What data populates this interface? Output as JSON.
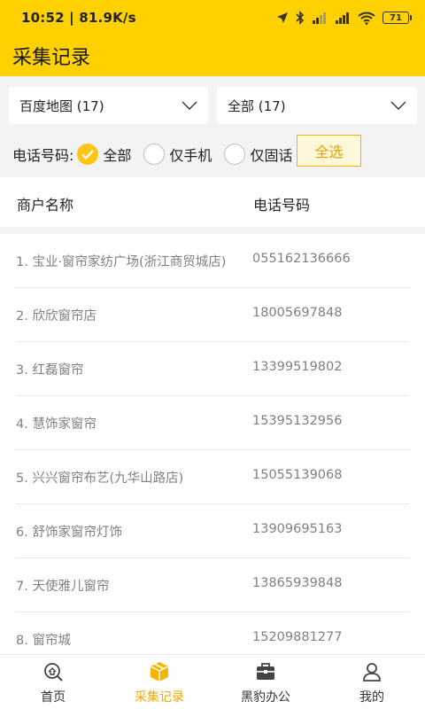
{
  "status_bar": {
    "time_speed": "10:52 | 81.9K/s",
    "battery": "71"
  },
  "header": {
    "title": "采集记录"
  },
  "filters": {
    "source_dropdown": "百度地图 (17)",
    "category_dropdown": "全部 (17)",
    "phone_label": "电话号码:",
    "phone_options": [
      "全部",
      "仅手机",
      "仅固话"
    ],
    "selected_option": "全部",
    "select_all_label": "全选"
  },
  "table": {
    "headers": {
      "name": "商户名称",
      "phone": "电话号码"
    },
    "rows": [
      {
        "name": "1. 宝业·窗帘家纺广场(浙江商贸城店)",
        "phone": "055162136666"
      },
      {
        "name": "2. 欣欣窗帘店",
        "phone": "18005697848"
      },
      {
        "name": "3. 红磊窗帘",
        "phone": "13399519802"
      },
      {
        "name": "4. 慧饰家窗帘",
        "phone": "15395132956"
      },
      {
        "name": "5. 兴兴窗帘布艺(九华山路店)",
        "phone": "15055139068"
      },
      {
        "name": "6. 舒饰家窗帘灯饰",
        "phone": "13909695163"
      },
      {
        "name": "7. 天使雅儿窗帘",
        "phone": "13865939848"
      },
      {
        "name": "8. 窗帘城",
        "phone": "15209881277"
      }
    ]
  },
  "tabbar": {
    "items": [
      {
        "label": "首页",
        "icon": "home-search-icon",
        "active": false
      },
      {
        "label": "采集记录",
        "icon": "box-icon",
        "active": true
      },
      {
        "label": "黑豹办公",
        "icon": "briefcase-icon",
        "active": false
      },
      {
        "label": "我的",
        "icon": "user-icon",
        "active": false
      }
    ]
  },
  "colors": {
    "accent": "#FFD100",
    "active_tab": "#F0A800",
    "checked_radio": "#FFC517"
  }
}
